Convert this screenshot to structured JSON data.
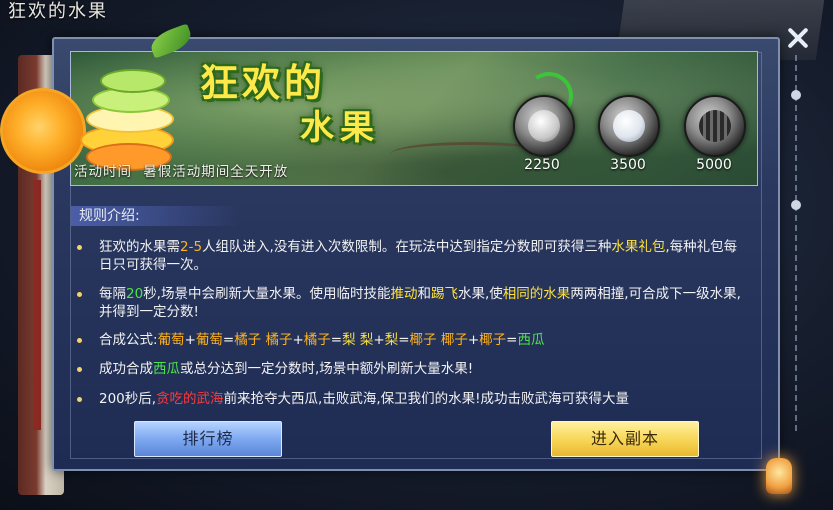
{
  "window": {
    "title": "狂欢的水果"
  },
  "banner": {
    "logo_line1": "狂欢的",
    "logo_line2": "水果",
    "activity_time_label": "活动时间",
    "activity_time_value": "暑假活动期间全天开放",
    "rewards": [
      {
        "icon": "white-gift-ball-icon",
        "value": "2250"
      },
      {
        "icon": "silver-gift-ball-icon",
        "value": "3500"
      },
      {
        "icon": "watermelon-gift-ball-icon",
        "value": "5000"
      }
    ]
  },
  "rules": {
    "title": "规则介绍:",
    "items": [
      {
        "segments": [
          {
            "t": "狂欢的水果需",
            "c": ""
          },
          {
            "t": "2-5",
            "c": "o"
          },
          {
            "t": "人组队进入,没有进入次数限制。在玩法中达到指定分数即可获得三种",
            "c": ""
          },
          {
            "t": "水果礼包",
            "c": "y"
          },
          {
            "t": ",每种礼包每日只可获得一次。",
            "c": ""
          }
        ]
      },
      {
        "segments": [
          {
            "t": "每隔",
            "c": ""
          },
          {
            "t": "20",
            "c": "g"
          },
          {
            "t": "秒,场景中会刷新大量水果。使用临时技能",
            "c": ""
          },
          {
            "t": "推动",
            "c": "y"
          },
          {
            "t": "和",
            "c": ""
          },
          {
            "t": "踢飞",
            "c": "y"
          },
          {
            "t": "水果,使",
            "c": ""
          },
          {
            "t": "相同的水果",
            "c": "y"
          },
          {
            "t": "两两相撞,可合成下一级水果,并得到一定分数!",
            "c": ""
          }
        ]
      },
      {
        "segments": [
          {
            "t": "合成公式:",
            "c": ""
          },
          {
            "t": "葡萄",
            "c": "o"
          },
          {
            "t": "+",
            "c": ""
          },
          {
            "t": "葡萄",
            "c": "o"
          },
          {
            "t": "=",
            "c": ""
          },
          {
            "t": "橘子",
            "c": "o"
          },
          {
            "t": "  ",
            "c": ""
          },
          {
            "t": "橘子",
            "c": "o"
          },
          {
            "t": "+",
            "c": ""
          },
          {
            "t": "橘子",
            "c": "o"
          },
          {
            "t": "=",
            "c": ""
          },
          {
            "t": "梨",
            "c": "y"
          },
          {
            "t": "  ",
            "c": ""
          },
          {
            "t": "梨",
            "c": "y"
          },
          {
            "t": "+",
            "c": ""
          },
          {
            "t": "梨",
            "c": "y"
          },
          {
            "t": "=",
            "c": ""
          },
          {
            "t": "椰子",
            "c": "o"
          },
          {
            "t": "   ",
            "c": ""
          },
          {
            "t": "椰子",
            "c": "o"
          },
          {
            "t": "+",
            "c": ""
          },
          {
            "t": "椰子",
            "c": "o"
          },
          {
            "t": "=",
            "c": ""
          },
          {
            "t": "西瓜",
            "c": "g"
          }
        ]
      },
      {
        "segments": [
          {
            "t": "成功合成",
            "c": ""
          },
          {
            "t": "西瓜",
            "c": "g"
          },
          {
            "t": "或总分达到一定分数时,场景中额外刷新大量水果!",
            "c": ""
          }
        ]
      },
      {
        "segments": [
          {
            "t": "200秒后,",
            "c": ""
          },
          {
            "t": "贪吃的武海",
            "c": "r"
          },
          {
            "t": "前来抢夺大西瓜,击败武海,保卫我们的水果!成功击败武海可获得大量",
            "c": ""
          }
        ]
      }
    ]
  },
  "buttons": {
    "rank_label": "排行榜",
    "enter_label": "进入副本"
  },
  "colors": {
    "yellow": "#ffe23a",
    "orange": "#ffb21a",
    "green": "#4ee34a",
    "red": "#ff3a3a"
  }
}
